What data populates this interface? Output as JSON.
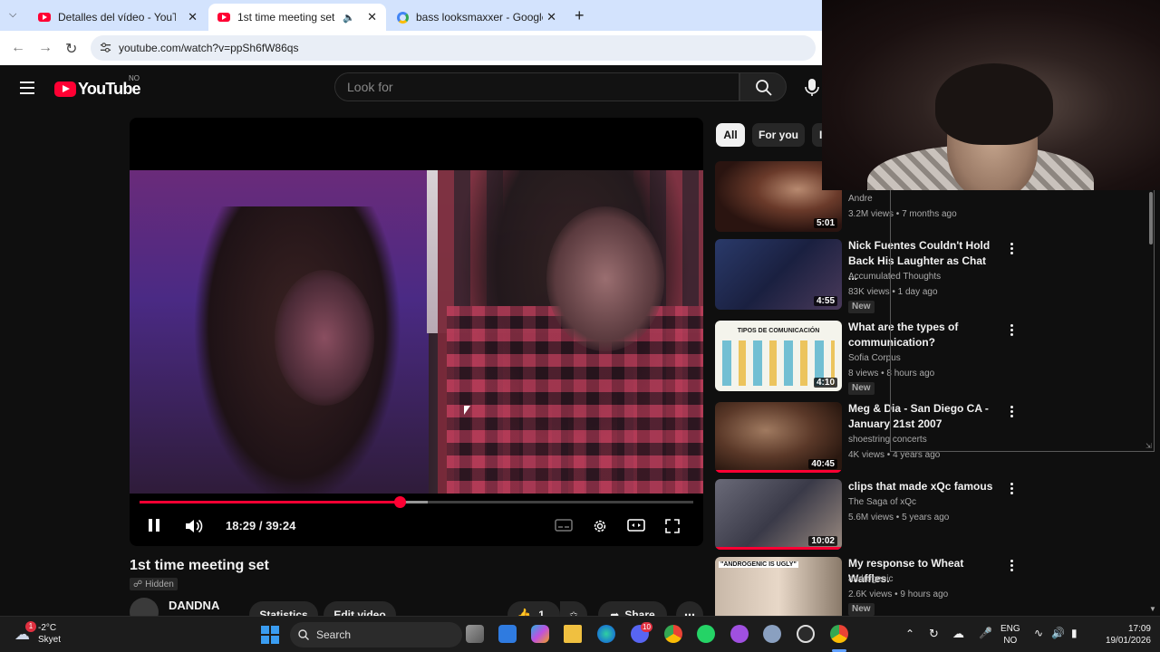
{
  "browser": {
    "tabs": [
      {
        "title": "Detalles del vídeo - YouTube Studio",
        "favicon": "youtube-icon",
        "active": false
      },
      {
        "title": "1st time meeting set - YouTube",
        "favicon": "youtube-icon",
        "active": true
      },
      {
        "title": "bass looksmaxxer - Google Search",
        "favicon": "google-icon",
        "active": false
      }
    ],
    "url": "youtube.com/watch?v=ppSh6fW86qs"
  },
  "youtube": {
    "logo_text": "YouTube",
    "region": "NO",
    "search_placeholder": "Look for"
  },
  "player": {
    "current_time": "18:29",
    "duration": "39:24",
    "time_display": "18:29 / 39:24",
    "progress_fraction": 0.469,
    "buffered_fraction": 0.52
  },
  "video": {
    "title": "1st time meeting set",
    "privacy": "Hidden",
    "channel": "DANDNA",
    "statistics_label": "Statistics",
    "edit_label": "Edit video",
    "like_count": "1",
    "share_label": "Share"
  },
  "chips": [
    "All",
    "For you",
    "I"
  ],
  "recommendations": [
    {
      "title": "",
      "channel": "Andre",
      "meta": "3.2M views • 7 months ago",
      "duration": "5:01",
      "new": false
    },
    {
      "title": "Nick Fuentes Couldn't Hold Back His Laughter as Chat ...",
      "channel": "Accumulated Thoughts",
      "meta": "83K views • 1 day ago",
      "duration": "4:55",
      "new": true
    },
    {
      "title": "What are the types of communication?",
      "channel": "Sofia Corpus",
      "meta": "8 views • 8 hours ago",
      "duration": "4:10",
      "new": true,
      "thumb_text": "TIPOS DE COMUNICACIÓN"
    },
    {
      "title": "Meg & Dia - San Diego CA - January 21st 2007",
      "channel": "shoestring concerts",
      "meta": "4K views • 4 years ago",
      "duration": "40:45",
      "new": false
    },
    {
      "title": "clips that made xQc famous",
      "channel": "The Saga of xQc",
      "meta": "5.6M views • 5 years ago",
      "duration": "10:02",
      "new": false
    },
    {
      "title": "My response to Wheat Waffles.",
      "channel": "androgenic",
      "meta": "2.6K views • 9 hours ago",
      "duration": "",
      "new": true,
      "thumb_text": "\"ANDROGENIC IS UGLY\""
    }
  ],
  "new_badge": "New",
  "taskbar": {
    "weather_temp": "-2°C",
    "weather_desc": "Skyet",
    "search_label": "Search",
    "lang_top": "ENG",
    "lang_bottom": "NO",
    "time": "17:09",
    "date": "19/01/2026",
    "discord_badge": "10",
    "weather_badge": "1"
  }
}
